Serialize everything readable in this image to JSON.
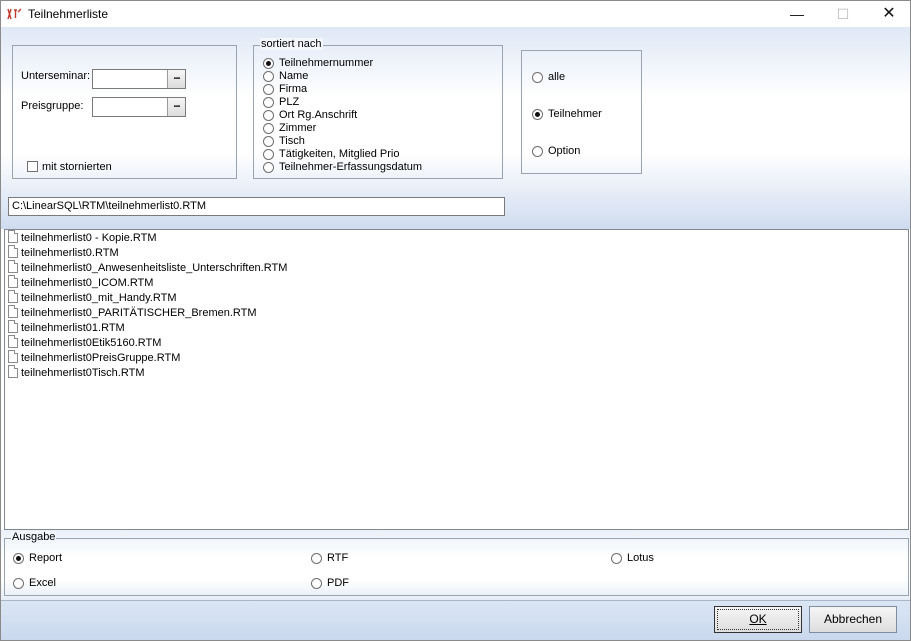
{
  "window": {
    "title": "Teilnehmerliste",
    "minimize_glyph": "—",
    "maximize_glyph": "☐",
    "close_glyph": "✕"
  },
  "filters": {
    "unterseminar_label": "Unterseminar:",
    "unterseminar_value": "",
    "preisgruppe_label": "Preisgruppe:",
    "preisgruppe_value": "",
    "browse_glyph": "...",
    "storniert_label": "mit stornierten",
    "storniert_checked": false
  },
  "sort": {
    "legend": "sortiert nach",
    "selected": 0,
    "options": [
      "Teilnehmernummer",
      "Name",
      "Firma",
      "PLZ",
      "Ort Rg.Anschrift",
      "Zimmer",
      "Tisch",
      "Tätigkeiten, Mitglied Prio",
      "Teilnehmer-Erfassungsdatum"
    ]
  },
  "scope": {
    "selected": 1,
    "options": [
      "alle",
      "Teilnehmer",
      "Option"
    ]
  },
  "path": "C:\\LinearSQL\\RTM\\teilnehmerlist0.RTM",
  "files": [
    "teilnehmerlist0 - Kopie.RTM",
    "teilnehmerlist0.RTM",
    "teilnehmerlist0_Anwesenheitsliste_Unterschriften.RTM",
    "teilnehmerlist0_ICOM.RTM",
    "teilnehmerlist0_mit_Handy.RTM",
    "teilnehmerlist0_PARITÄTISCHER_Bremen.RTM",
    "teilnehmerlist01.RTM",
    "teilnehmerlist0Etik5160.RTM",
    "teilnehmerlist0PreisGruppe.RTM",
    "teilnehmerlist0Tisch.RTM"
  ],
  "output": {
    "legend": "Ausgabe",
    "selected": 0,
    "options": [
      "Report",
      "RTF",
      "Lotus",
      "Excel",
      "PDF"
    ]
  },
  "buttons": {
    "ok": "OK",
    "cancel": "Abbrechen"
  },
  "colors": {
    "accent_band": "#cfdcf0",
    "button_bar": "#c9d8ee"
  }
}
